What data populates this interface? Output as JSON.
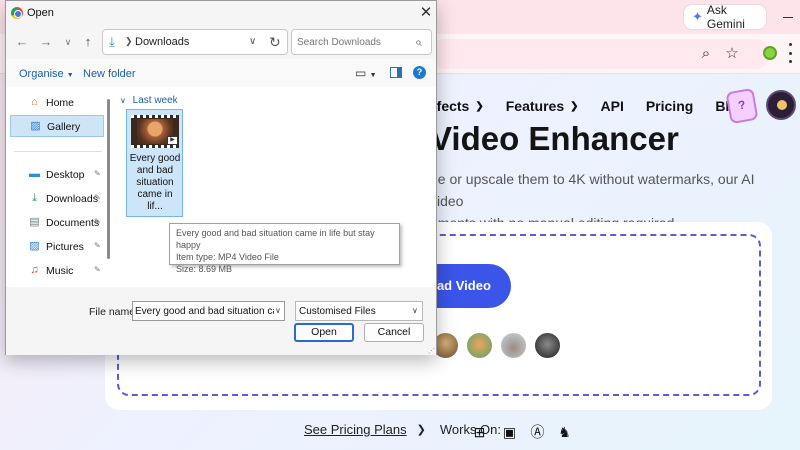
{
  "browser": {
    "ask_gemini": "Ask Gemini",
    "nav": [
      {
        "label": "ffects",
        "has_chevron": true
      },
      {
        "label": "Features",
        "has_chevron": true
      },
      {
        "label": "API",
        "has_chevron": false
      },
      {
        "label": "Pricing",
        "has_chevron": false
      },
      {
        "label": "Blog",
        "has_chevron": false
      }
    ],
    "hero_title": "Video Enhancer",
    "hero_sub_line1": "ee or upscale them to 4K without watermarks, our AI video",
    "hero_sub_line2": "ements with no manual editing required.",
    "upload_button": "oad Video",
    "see_pricing": "See Pricing Plans",
    "works_on": "Works On:",
    "accent_color": "#3a55e8"
  },
  "dialog": {
    "title": "Open",
    "path": "Downloads",
    "search_placeholder": "Search Downloads",
    "organise": "Organise",
    "new_folder": "New folder",
    "sidebar": {
      "home": "Home",
      "gallery": "Gallery",
      "desktop": "Desktop",
      "downloads": "Downloads",
      "documents": "Documents",
      "pictures": "Pictures",
      "music": "Music"
    },
    "group_header": "Last week",
    "file": {
      "name_line1": "Every good",
      "name_line2": "and bad",
      "name_line3": "situation",
      "name_line4": "came in lif..."
    },
    "tooltip": {
      "line1": "Every good and bad situation came in life but stay happy",
      "line2": "Item type: MP4 Video File",
      "line3": "Size: 8.69 MB"
    },
    "file_name_label": "File name:",
    "file_name_value": "Every good and bad situation came in life but stay happy",
    "file_type": "Customised Files",
    "open_button": "Open",
    "cancel_button": "Cancel"
  }
}
